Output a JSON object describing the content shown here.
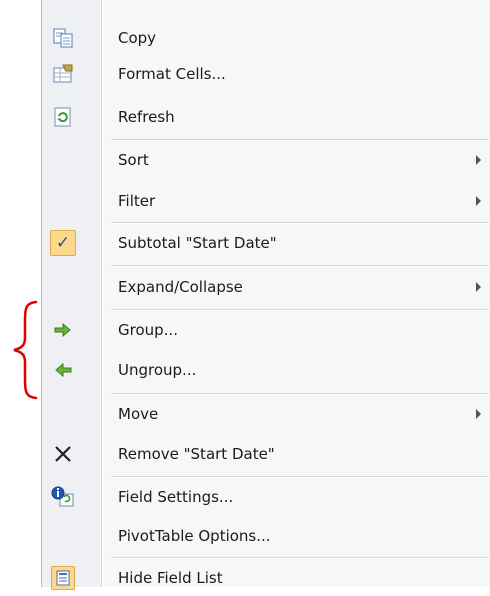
{
  "menu": {
    "items": [
      {
        "key": "copy",
        "label": "Copy",
        "icon": "copy-icon"
      },
      {
        "key": "format_cells",
        "label": "Format Cells...",
        "icon": "format-cells-icon"
      },
      {
        "key": "refresh",
        "label": "Refresh",
        "icon": "refresh-icon"
      },
      {
        "key": "sort",
        "label": "Sort",
        "submenu": true
      },
      {
        "key": "filter",
        "label": "Filter",
        "submenu": true
      },
      {
        "key": "subtotal",
        "label": "Subtotal \"Start Date\"",
        "checked": true,
        "icon": "checkmark-icon"
      },
      {
        "key": "expand_collapse",
        "label": "Expand/Collapse",
        "submenu": true
      },
      {
        "key": "group",
        "label": "Group...",
        "icon": "group-arrow-icon"
      },
      {
        "key": "ungroup",
        "label": "Ungroup...",
        "icon": "ungroup-arrow-icon"
      },
      {
        "key": "move",
        "label": "Move",
        "submenu": true
      },
      {
        "key": "remove",
        "label": "Remove \"Start Date\"",
        "icon": "remove-x-icon"
      },
      {
        "key": "field_settings",
        "label": "Field Settings...",
        "icon": "field-settings-icon"
      },
      {
        "key": "pivot_options",
        "label": "PivotTable Options..."
      },
      {
        "key": "hide_field_list",
        "label": "Hide Field List",
        "icon": "field-list-icon"
      }
    ]
  },
  "colors": {
    "menu_bg": "#f7f7f7",
    "gutter_bg": "#eef0f3",
    "check_bg": "#fdd98b",
    "brace": "#e00000",
    "group_arrow": "#5aa02c"
  }
}
